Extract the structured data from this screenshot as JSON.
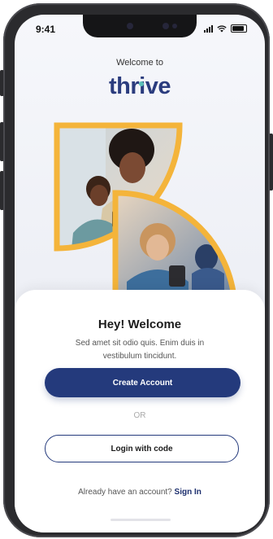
{
  "status_bar": {
    "time": "9:41"
  },
  "header": {
    "welcome_text": "Welcome to",
    "brand_name": "thrive",
    "brand_colors": {
      "primary": "#243a7c",
      "accent": "#5dc1b9",
      "frame": "#f4b43a"
    }
  },
  "welcome_card": {
    "title": "Hey! Welcome",
    "subtitle": "Sed amet sit odio quis. Enim duis in vestibulum tincidunt.",
    "create_account_label": "Create Account",
    "or_label": "OR",
    "login_code_label": "Login with code",
    "already_text": "Already have an account?",
    "sign_in_label": "Sign In"
  },
  "icons": [
    "signal-icon",
    "wifi-icon",
    "battery-icon"
  ]
}
